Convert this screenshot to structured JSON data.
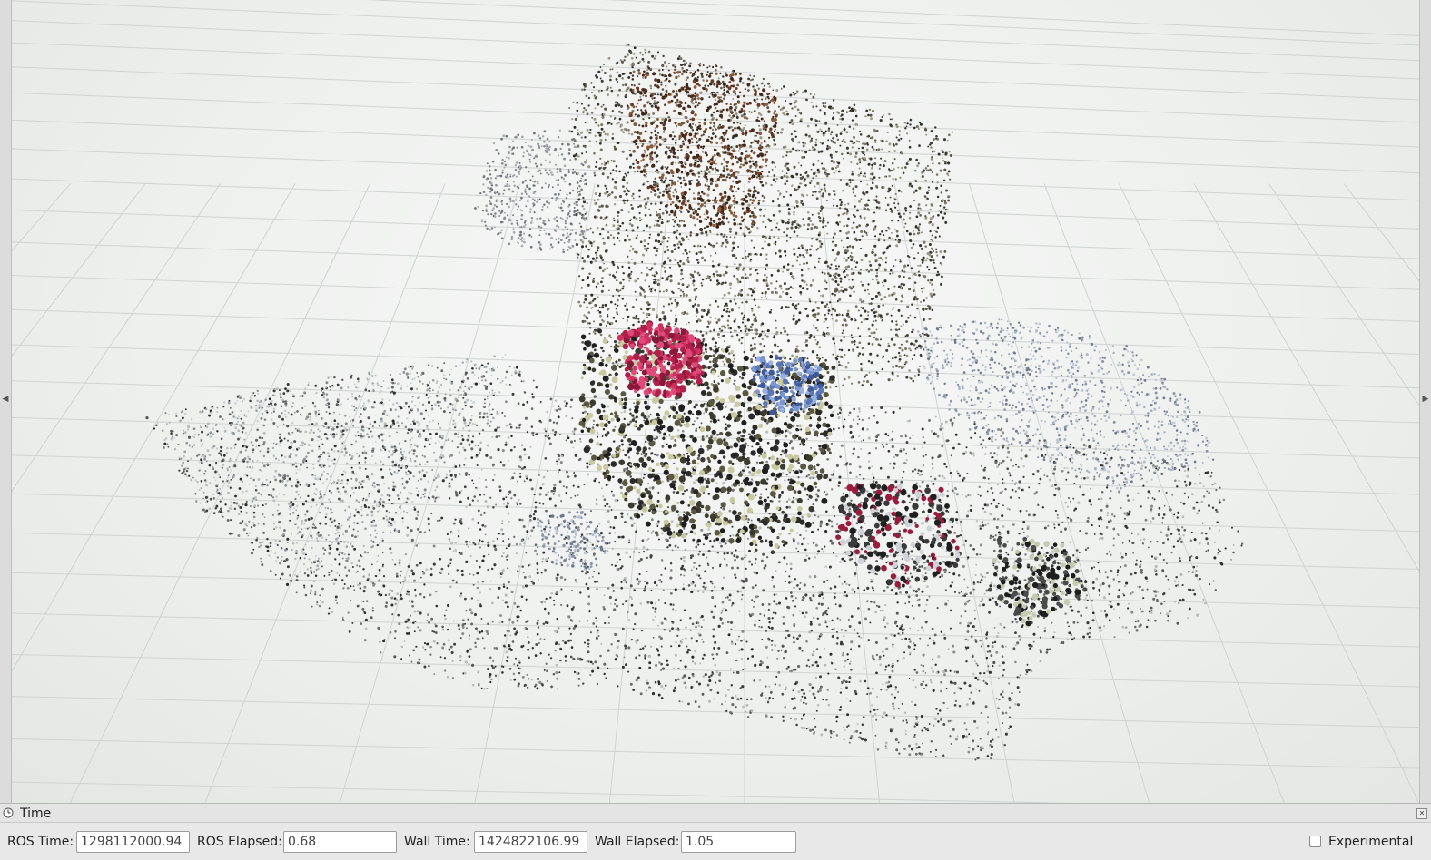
{
  "time_panel": {
    "title": "Time",
    "ros_time_label": "ROS Time:",
    "ros_time_value": "1298112000.94",
    "ros_elapsed_label": "ROS Elapsed:",
    "ros_elapsed_value": "0.68",
    "wall_time_label": "Wall Time:",
    "wall_time_value": "1424822106.99",
    "wall_elapsed_label": "Wall Elapsed:",
    "wall_elapsed_value": "1.05",
    "experimental_label": "Experimental",
    "experimental_checked": false
  },
  "viewport": {
    "content": "point-cloud",
    "grid": true,
    "background_color": "#eef0ee",
    "grid_color": "#cfd3d1"
  },
  "icons": {
    "time_panel": "clock-icon",
    "left_splitter": "left-arrow-icon",
    "right_splitter": "right-arrow-icon",
    "close_panel": "close-icon"
  }
}
